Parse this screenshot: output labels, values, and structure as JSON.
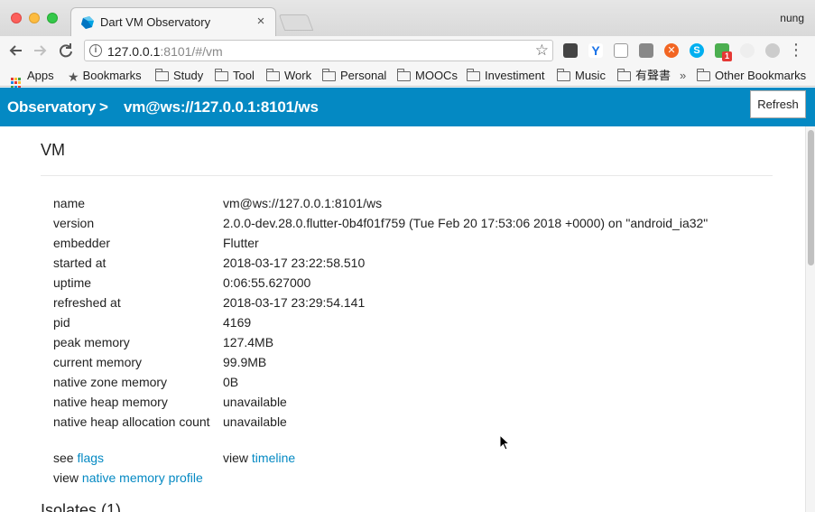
{
  "browser": {
    "tab_title": "Dart VM Observatory",
    "tab_close": "×",
    "profile_name": "nung",
    "url_host": "127.0.0.1",
    "url_rest": ":8101/#/vm",
    "bookmarks": [
      {
        "label": "Apps",
        "icon": "apps-grid-icon"
      },
      {
        "label": "Bookmarks",
        "icon": "star-icon"
      },
      {
        "label": "Study",
        "icon": "folder-icon"
      },
      {
        "label": "Tool",
        "icon": "folder-icon"
      },
      {
        "label": "Work",
        "icon": "folder-icon"
      },
      {
        "label": "Personal",
        "icon": "folder-icon"
      },
      {
        "label": "MOOCs",
        "icon": "folder-icon"
      },
      {
        "label": "Investiment",
        "icon": "folder-icon"
      },
      {
        "label": "Music",
        "icon": "folder-icon"
      },
      {
        "label": "有聲書",
        "icon": "folder-icon"
      }
    ],
    "bookmarks_overflow": "»",
    "other_bookmarks": "Other Bookmarks",
    "extension_badge": "1"
  },
  "navbar": {
    "crumb_home": "Observatory",
    "separator": ">",
    "crumb_vm": "vm@ws://127.0.0.1:8101/ws",
    "refresh_label": "Refresh",
    "color": "#0489c3"
  },
  "vm": {
    "title": "VM",
    "properties": [
      {
        "key": "name",
        "value": "vm@ws://127.0.0.1:8101/ws"
      },
      {
        "key": "version",
        "value": "2.0.0-dev.28.0.flutter-0b4f01f759 (Tue Feb 20 17:53:06 2018 +0000) on \"android_ia32\""
      },
      {
        "key": "embedder",
        "value": "Flutter"
      },
      {
        "key": "started at",
        "value": "2018-03-17 23:22:58.510"
      },
      {
        "key": "uptime",
        "value": "0:06:55.627000"
      },
      {
        "key": "refreshed at",
        "value": "2018-03-17 23:29:54.141"
      },
      {
        "key": "pid",
        "value": "4169"
      },
      {
        "key": "peak memory",
        "value": "127.4MB"
      },
      {
        "key": "current memory",
        "value": "99.9MB"
      },
      {
        "key": "native zone memory",
        "value": "0B"
      },
      {
        "key": "native heap memory",
        "value": "unavailable"
      },
      {
        "key": "native heap allocation count",
        "value": "unavailable"
      }
    ],
    "links": {
      "see_prefix": "see",
      "flags": "flags",
      "view_prefix": "view",
      "timeline": "timeline",
      "view_prefix_2": "view",
      "native_memory_profile": "native memory profile"
    },
    "isolates_title": "Isolates (1)"
  }
}
